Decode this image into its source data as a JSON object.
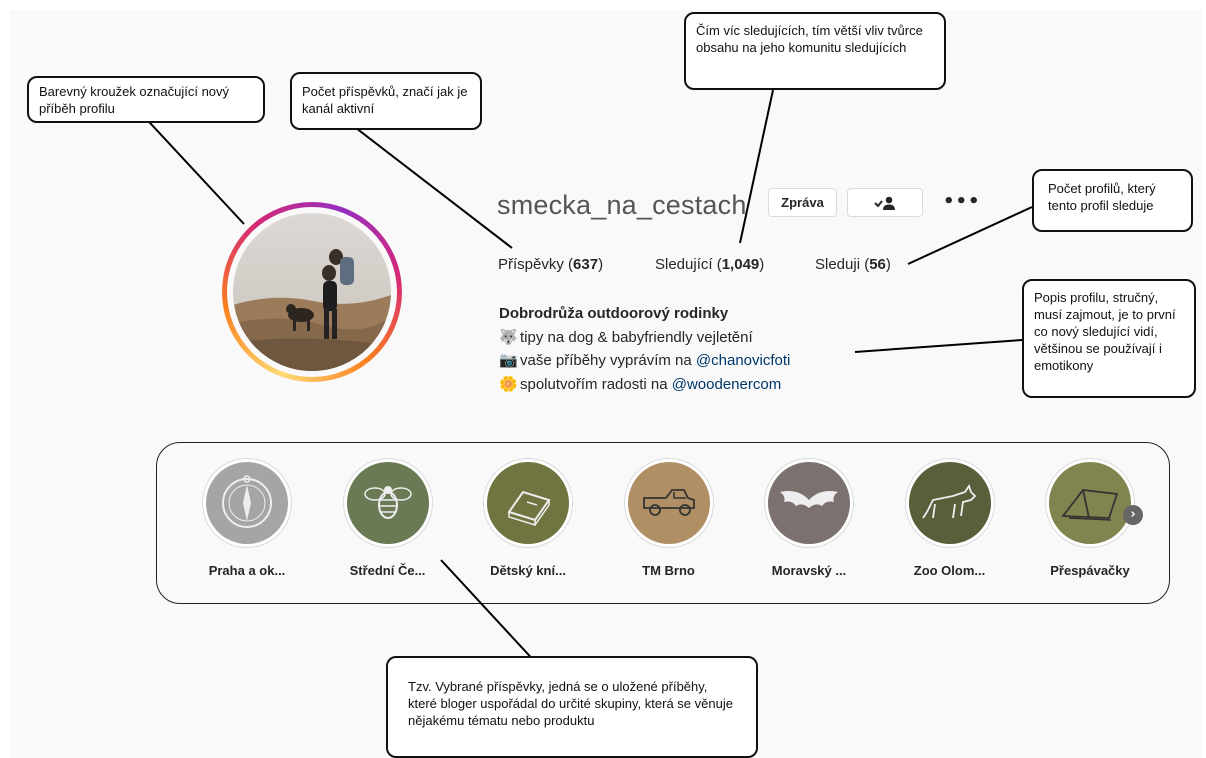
{
  "profile": {
    "username": "smecka_na_cestach",
    "message_button": "Zpráva",
    "more_label": "•••",
    "stats": {
      "posts_label": "Příspěvky",
      "posts_count": "637",
      "followers_label": "Sledující",
      "followers_count": "1,049",
      "following_label": "Sleduji",
      "following_count": "56"
    },
    "bio": {
      "name": "Dobrodrůža outdoorový rodinky",
      "line1_emoji": "🐺",
      "line1_text": "tipy na dog & babyfriendly vejletění",
      "line2_emoji": "📷",
      "line2_text": "vaše příběhy vyprávím na",
      "line2_link": "@chanovicfoti",
      "line3_emoji": "🌼",
      "line3_text": "spolutvořím radosti na",
      "line3_link": "@woodenercom"
    }
  },
  "highlights": [
    {
      "label": "Praha a ok...",
      "color": "#a5a5a5",
      "icon": "compass-icon"
    },
    {
      "label": "Střední Če...",
      "color": "#6a7a55",
      "icon": "bee-icon"
    },
    {
      "label": "Dětský kní...",
      "color": "#6f7440",
      "icon": "book-icon"
    },
    {
      "label": "TM Brno",
      "color": "#b08f64",
      "icon": "truck-icon"
    },
    {
      "label": "Moravský ...",
      "color": "#7b716e",
      "icon": "bat-icon"
    },
    {
      "label": "Zoo Olom...",
      "color": "#5b5e3b",
      "icon": "wolf-icon"
    },
    {
      "label": "Přespávačky",
      "color": "#82844f",
      "icon": "tent-icon"
    }
  ],
  "highlights_next_icon": "›",
  "callouts": {
    "avatar": "Barevný kroužek označující nový příběh profilu",
    "posts": "Počet příspěvků, značí jak je kanál aktivní",
    "followers": "Čím víc sledujících, tím větší vliv tvůrce obsahu na jeho komunitu sledujících",
    "following": "Počet profilů, který tento profil sleduje",
    "bio": "Popis profilu, stručný, musí zajmout, je to první co nový sledující vidí, většinou se používají i emotikony",
    "highlights": "Tzv. Vybrané příspěvky, jedná se o uložené příběhy, které bloger uspořádal do určité skupiny, která se věnuje nějakému tématu nebo produktu"
  }
}
